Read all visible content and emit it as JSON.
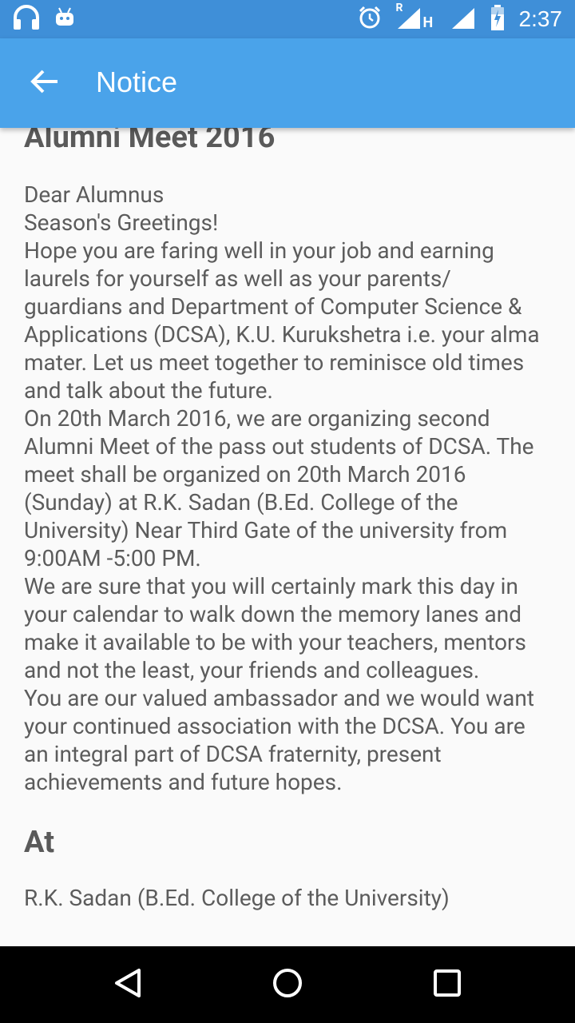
{
  "status_bar": {
    "time": "2:37",
    "icons": [
      "headphones-icon",
      "android-icon",
      "alarm-icon",
      "signal-icon",
      "h-signal-icon",
      "signal-icon",
      "battery-icon"
    ],
    "network_label": "R",
    "h_label": "H"
  },
  "app_bar": {
    "title": "Notice",
    "back_icon": "arrow-back-icon"
  },
  "notice": {
    "heading": "Alumni Meet 2016",
    "paragraphs": [
      "Dear Alumnus",
      "Season's Greetings!",
      "Hope you are faring well in your job and earning laurels for yourself as well as your parents/ guardians and Department of Computer Science & Applications (DCSA), K.U. Kurukshetra i.e. your alma mater. Let us meet together to reminisce old times and talk about the future.",
      "On 20th March 2016, we are organizing second Alumni Meet of the pass out students of DCSA. The meet shall be organized on 20th March 2016 (Sunday) at R.K. Sadan (B.Ed. College of the University) Near Third Gate of the university from 9:00AM -5:00 PM.",
      "We are sure that you will certainly mark this day in your calendar to walk down the memory lanes and make it available to be with your teachers, mentors and not the least, your friends and colleagues.",
      "You are our valued ambassador and we would want your continued association with the DCSA. You are an integral part of DCSA fraternity, present achievements and future hopes."
    ],
    "at_heading": "At",
    "venue": "R.K. Sadan (B.Ed. College of the University)"
  },
  "nav_bar": {
    "icons": [
      "back-triangle-icon",
      "home-circle-icon",
      "recents-square-icon"
    ]
  }
}
